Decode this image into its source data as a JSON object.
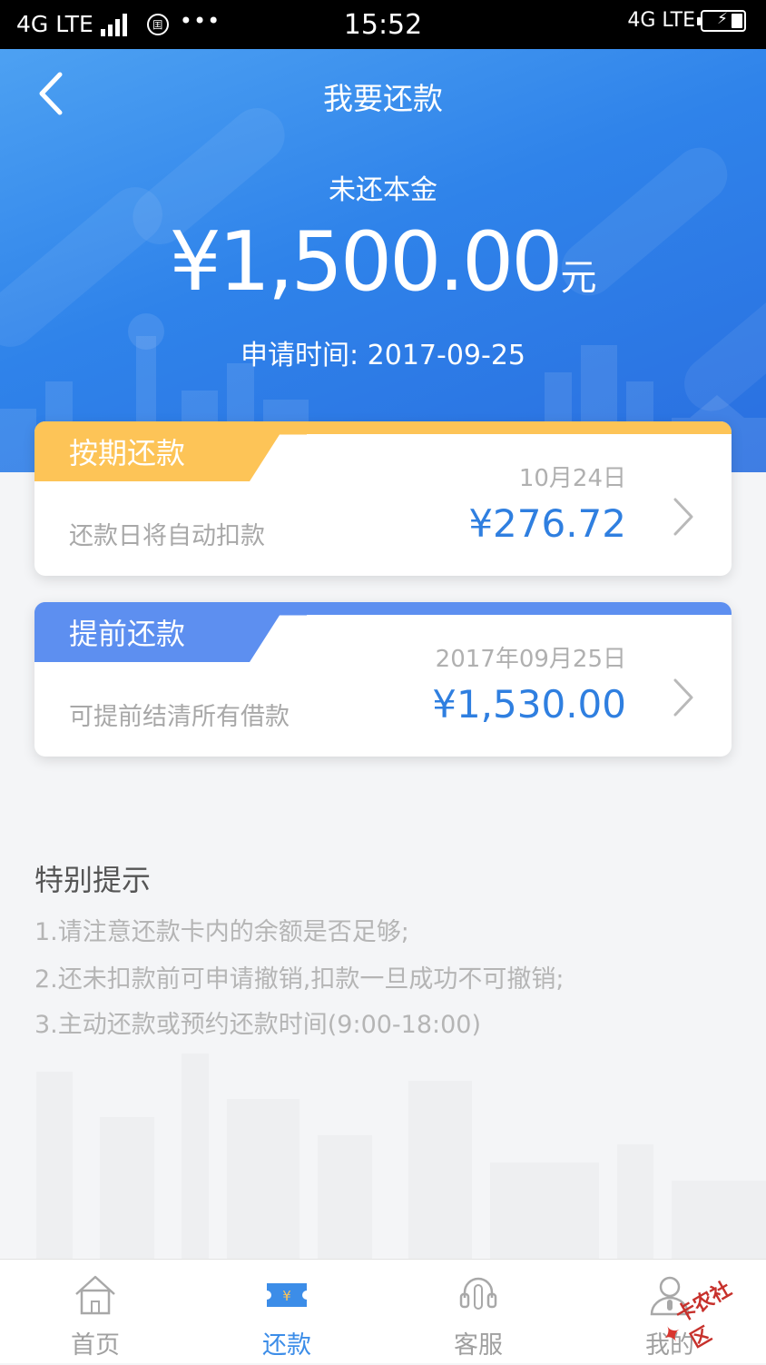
{
  "status_bar": {
    "network_left": "4G LTE",
    "time": "15:52",
    "network_right": "4G LTE",
    "icons": [
      "signal-bars-icon",
      "government-app-icon",
      "more-dots-icon",
      "battery-charging-icon"
    ]
  },
  "header": {
    "title": "我要还款",
    "back_icon": "chevron-left-icon"
  },
  "summary": {
    "label": "未还本金",
    "amount": "¥1,500.00",
    "unit": "元",
    "apply_time": "申请时间: 2017-09-25"
  },
  "repayment_options": [
    {
      "tab_label": "按期还款",
      "hint": "还款日将自动扣款",
      "date": "10月24日",
      "amount": "¥276.72",
      "accent_color": "#fdc457"
    },
    {
      "tab_label": "提前还款",
      "hint": "可提前结清所有借款",
      "date": "2017年09月25日",
      "amount": "¥1,530.00",
      "accent_color": "#5d8ff0"
    }
  ],
  "tips": {
    "title": "特别提示",
    "items": [
      "1.请注意还款卡内的余额是否足够;",
      "2.还未扣款前可申请撤销,扣款一旦成功不可撤销;",
      "3.主动还款或预约还款时间(9:00-18:00)"
    ]
  },
  "tab_bar": {
    "items": [
      {
        "label": "首页",
        "icon": "home-icon"
      },
      {
        "label": "还款",
        "icon": "repay-ticket-icon",
        "active": true
      },
      {
        "label": "客服",
        "icon": "headset-icon"
      },
      {
        "label": "我的",
        "icon": "user-icon"
      }
    ]
  },
  "watermark": {
    "text": "卡农社区"
  },
  "colors": {
    "primary_blue": "#2f83ea",
    "amount_blue": "#2f7fe0",
    "active_tab": "#3c8de8",
    "orange_accent": "#fdc457",
    "blue_accent": "#5d8ff0"
  }
}
